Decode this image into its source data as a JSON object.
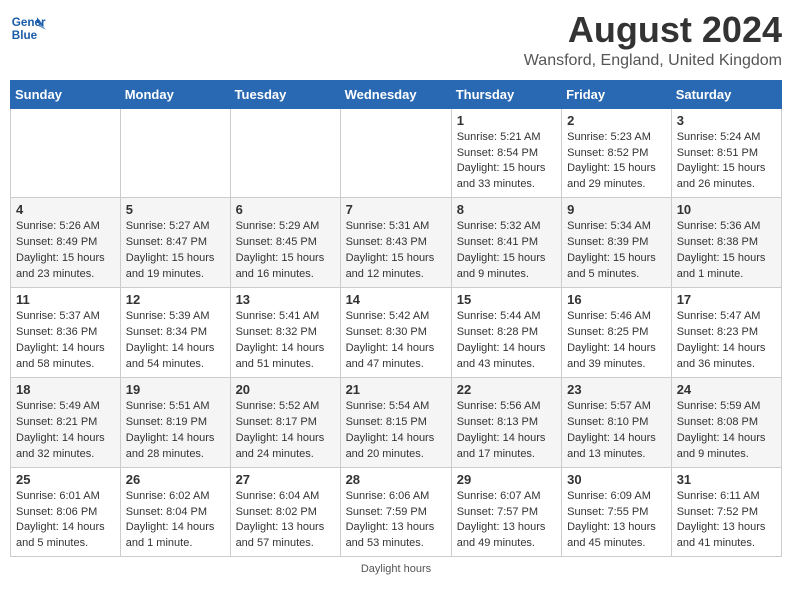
{
  "header": {
    "logo_line1": "General",
    "logo_line2": "Blue",
    "month_year": "August 2024",
    "location": "Wansford, England, United Kingdom"
  },
  "days_of_week": [
    "Sunday",
    "Monday",
    "Tuesday",
    "Wednesday",
    "Thursday",
    "Friday",
    "Saturday"
  ],
  "weeks": [
    [
      {
        "day": "",
        "info": ""
      },
      {
        "day": "",
        "info": ""
      },
      {
        "day": "",
        "info": ""
      },
      {
        "day": "",
        "info": ""
      },
      {
        "day": "1",
        "info": "Sunrise: 5:21 AM\nSunset: 8:54 PM\nDaylight: 15 hours\nand 33 minutes."
      },
      {
        "day": "2",
        "info": "Sunrise: 5:23 AM\nSunset: 8:52 PM\nDaylight: 15 hours\nand 29 minutes."
      },
      {
        "day": "3",
        "info": "Sunrise: 5:24 AM\nSunset: 8:51 PM\nDaylight: 15 hours\nand 26 minutes."
      }
    ],
    [
      {
        "day": "4",
        "info": "Sunrise: 5:26 AM\nSunset: 8:49 PM\nDaylight: 15 hours\nand 23 minutes."
      },
      {
        "day": "5",
        "info": "Sunrise: 5:27 AM\nSunset: 8:47 PM\nDaylight: 15 hours\nand 19 minutes."
      },
      {
        "day": "6",
        "info": "Sunrise: 5:29 AM\nSunset: 8:45 PM\nDaylight: 15 hours\nand 16 minutes."
      },
      {
        "day": "7",
        "info": "Sunrise: 5:31 AM\nSunset: 8:43 PM\nDaylight: 15 hours\nand 12 minutes."
      },
      {
        "day": "8",
        "info": "Sunrise: 5:32 AM\nSunset: 8:41 PM\nDaylight: 15 hours\nand 9 minutes."
      },
      {
        "day": "9",
        "info": "Sunrise: 5:34 AM\nSunset: 8:39 PM\nDaylight: 15 hours\nand 5 minutes."
      },
      {
        "day": "10",
        "info": "Sunrise: 5:36 AM\nSunset: 8:38 PM\nDaylight: 15 hours\nand 1 minute."
      }
    ],
    [
      {
        "day": "11",
        "info": "Sunrise: 5:37 AM\nSunset: 8:36 PM\nDaylight: 14 hours\nand 58 minutes."
      },
      {
        "day": "12",
        "info": "Sunrise: 5:39 AM\nSunset: 8:34 PM\nDaylight: 14 hours\nand 54 minutes."
      },
      {
        "day": "13",
        "info": "Sunrise: 5:41 AM\nSunset: 8:32 PM\nDaylight: 14 hours\nand 51 minutes."
      },
      {
        "day": "14",
        "info": "Sunrise: 5:42 AM\nSunset: 8:30 PM\nDaylight: 14 hours\nand 47 minutes."
      },
      {
        "day": "15",
        "info": "Sunrise: 5:44 AM\nSunset: 8:28 PM\nDaylight: 14 hours\nand 43 minutes."
      },
      {
        "day": "16",
        "info": "Sunrise: 5:46 AM\nSunset: 8:25 PM\nDaylight: 14 hours\nand 39 minutes."
      },
      {
        "day": "17",
        "info": "Sunrise: 5:47 AM\nSunset: 8:23 PM\nDaylight: 14 hours\nand 36 minutes."
      }
    ],
    [
      {
        "day": "18",
        "info": "Sunrise: 5:49 AM\nSunset: 8:21 PM\nDaylight: 14 hours\nand 32 minutes."
      },
      {
        "day": "19",
        "info": "Sunrise: 5:51 AM\nSunset: 8:19 PM\nDaylight: 14 hours\nand 28 minutes."
      },
      {
        "day": "20",
        "info": "Sunrise: 5:52 AM\nSunset: 8:17 PM\nDaylight: 14 hours\nand 24 minutes."
      },
      {
        "day": "21",
        "info": "Sunrise: 5:54 AM\nSunset: 8:15 PM\nDaylight: 14 hours\nand 20 minutes."
      },
      {
        "day": "22",
        "info": "Sunrise: 5:56 AM\nSunset: 8:13 PM\nDaylight: 14 hours\nand 17 minutes."
      },
      {
        "day": "23",
        "info": "Sunrise: 5:57 AM\nSunset: 8:10 PM\nDaylight: 14 hours\nand 13 minutes."
      },
      {
        "day": "24",
        "info": "Sunrise: 5:59 AM\nSunset: 8:08 PM\nDaylight: 14 hours\nand 9 minutes."
      }
    ],
    [
      {
        "day": "25",
        "info": "Sunrise: 6:01 AM\nSunset: 8:06 PM\nDaylight: 14 hours\nand 5 minutes."
      },
      {
        "day": "26",
        "info": "Sunrise: 6:02 AM\nSunset: 8:04 PM\nDaylight: 14 hours\nand 1 minute."
      },
      {
        "day": "27",
        "info": "Sunrise: 6:04 AM\nSunset: 8:02 PM\nDaylight: 13 hours\nand 57 minutes."
      },
      {
        "day": "28",
        "info": "Sunrise: 6:06 AM\nSunset: 7:59 PM\nDaylight: 13 hours\nand 53 minutes."
      },
      {
        "day": "29",
        "info": "Sunrise: 6:07 AM\nSunset: 7:57 PM\nDaylight: 13 hours\nand 49 minutes."
      },
      {
        "day": "30",
        "info": "Sunrise: 6:09 AM\nSunset: 7:55 PM\nDaylight: 13 hours\nand 45 minutes."
      },
      {
        "day": "31",
        "info": "Sunrise: 6:11 AM\nSunset: 7:52 PM\nDaylight: 13 hours\nand 41 minutes."
      }
    ]
  ],
  "footer": {
    "daylight_label": "Daylight hours"
  }
}
